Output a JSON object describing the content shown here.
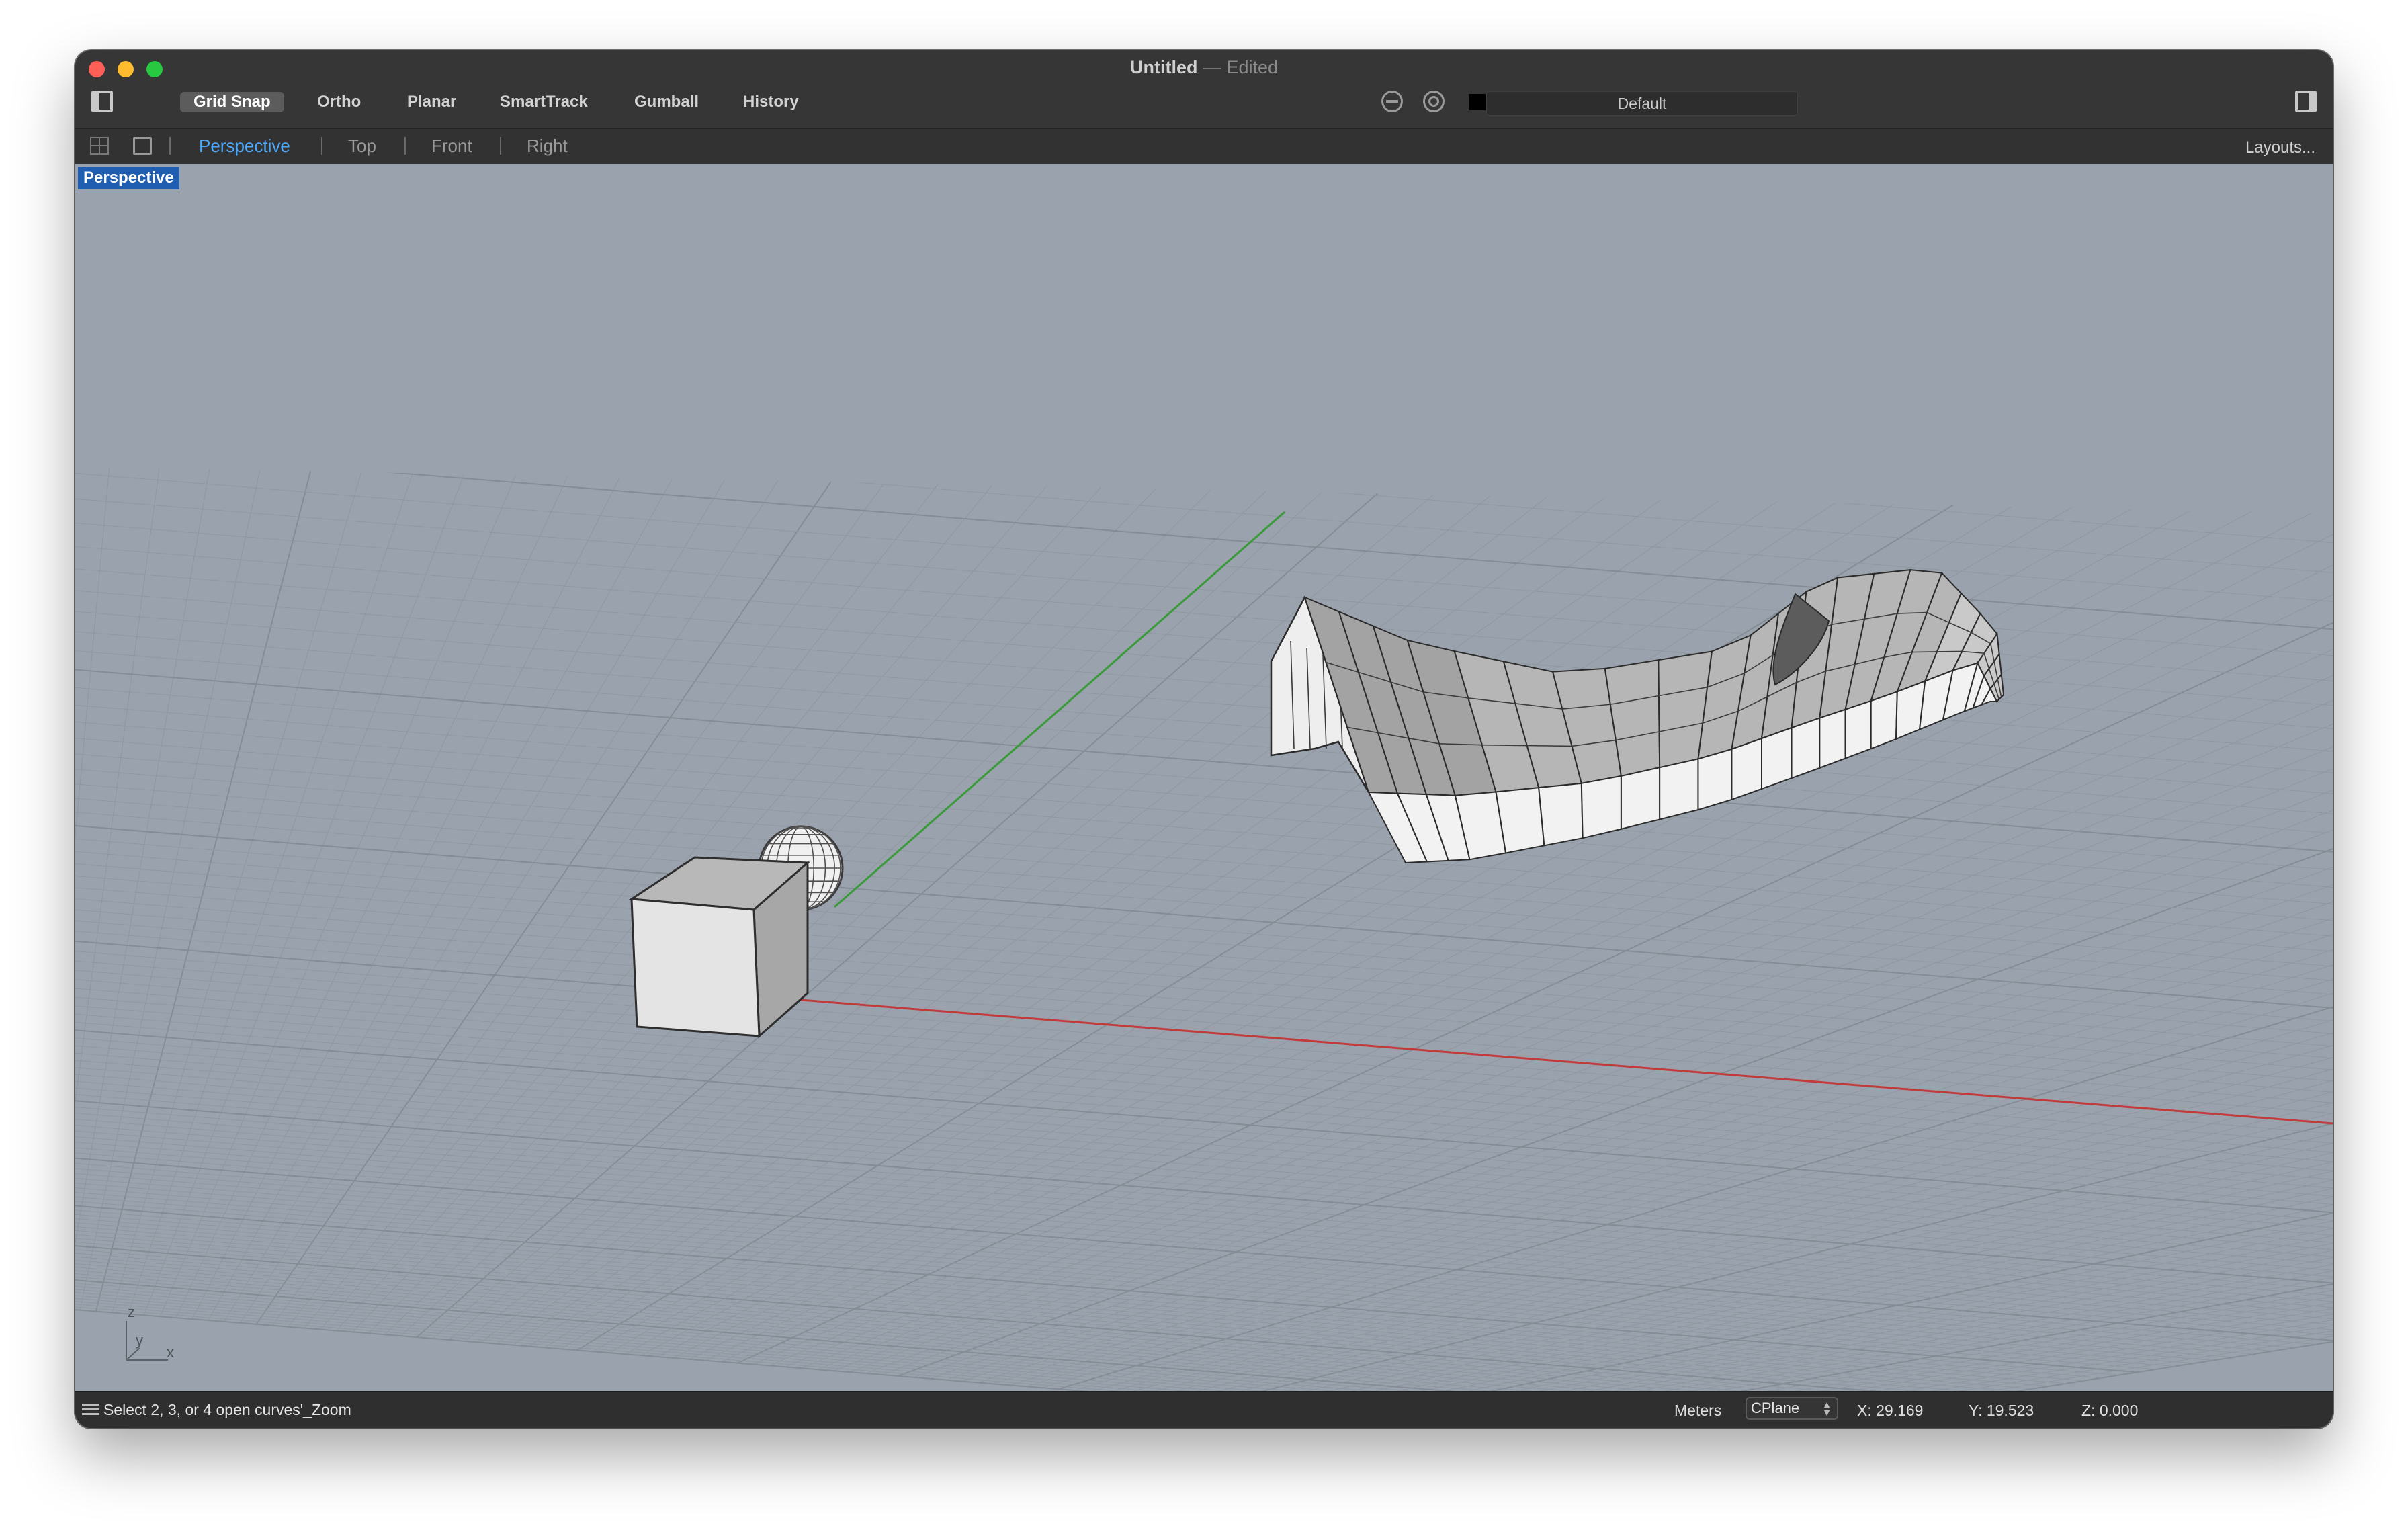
{
  "window": {
    "title": "Untitled",
    "separator": "—",
    "status": "Edited"
  },
  "toolbar": {
    "modes": [
      {
        "label": "Grid Snap",
        "active": true
      },
      {
        "label": "Ortho",
        "active": false
      },
      {
        "label": "Planar",
        "active": false
      },
      {
        "label": "SmartTrack",
        "active": false
      },
      {
        "label": "Gumball",
        "active": false
      },
      {
        "label": "History",
        "active": false
      }
    ],
    "layer": {
      "name": "Default",
      "color": "#000000"
    }
  },
  "viewbar": {
    "tabs": [
      {
        "label": "Perspective",
        "active": true
      },
      {
        "label": "Top",
        "active": false
      },
      {
        "label": "Front",
        "active": false
      },
      {
        "label": "Right",
        "active": false
      }
    ],
    "layouts_label": "Layouts..."
  },
  "viewport": {
    "label": "Perspective",
    "background": "#9aa3ad",
    "axis_labels": {
      "z": "z",
      "y": "y",
      "x": "x"
    },
    "axis_colors": {
      "x": "#c23b3b",
      "y": "#3a9a3a"
    }
  },
  "status": {
    "command": "Select 2, 3, or 4 open curves'_Zoom",
    "units": "Meters",
    "cplane": "CPlane",
    "x": "X: 29.169",
    "y": "Y: 19.523",
    "z": "Z: 0.000"
  }
}
